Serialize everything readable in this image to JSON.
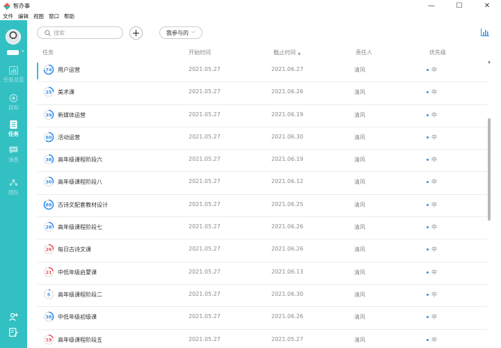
{
  "window": {
    "title": "智办事",
    "controls": [
      "—",
      "☐",
      "✕"
    ]
  },
  "menu": [
    "文件",
    "编辑",
    "视图",
    "窗口",
    "帮助"
  ],
  "sidebar": {
    "items": [
      {
        "label": "任务总览",
        "icon": "chart-icon",
        "active": false
      },
      {
        "label": "目标",
        "icon": "target-icon",
        "active": false
      },
      {
        "label": "任务",
        "icon": "task-list-icon",
        "active": true
      },
      {
        "label": "消息",
        "icon": "message-icon",
        "active": false
      },
      {
        "label": "团队",
        "icon": "team-icon",
        "active": false
      }
    ]
  },
  "toolbar": {
    "search_placeholder": "搜索",
    "add_label": "+",
    "filter_label": "我参与的"
  },
  "table": {
    "headers": {
      "task": "任务",
      "start": "开始时间",
      "end": "截止时间",
      "owner": "责任人",
      "priority": "优先级"
    },
    "rows": [
      {
        "progress": "74",
        "color": "#2d8cf0",
        "name": "用户运营",
        "start": "2021.05.27",
        "end": "2021.06.27",
        "owner": "清风",
        "priority": "中"
      },
      {
        "progress": "25",
        "color": "#2d8cf0",
        "name": "美术课",
        "start": "2021.05.27",
        "end": "2021.06.26",
        "owner": "清风",
        "priority": "中"
      },
      {
        "progress": "39",
        "color": "#2d8cf0",
        "name": "新媒体运营",
        "start": "2021.05.27",
        "end": "2021.06.19",
        "owner": "清风",
        "priority": "中"
      },
      {
        "progress": "60",
        "color": "#2d8cf0",
        "name": "活动运营",
        "start": "2021.05.27",
        "end": "2021.06.30",
        "owner": "清风",
        "priority": "中"
      },
      {
        "progress": "38",
        "color": "#2d8cf0",
        "name": "高年级课程阶段六",
        "start": "2021.05.27",
        "end": "2021.06.19",
        "owner": "清风",
        "priority": "中"
      },
      {
        "progress": "30",
        "color": "#2d8cf0",
        "name": "高年级课程阶段八",
        "start": "2021.05.27",
        "end": "2021.06.12",
        "owner": "清风",
        "priority": "中"
      },
      {
        "progress": "88",
        "color": "#2d8cf0",
        "name": "古诗文配套教材设计",
        "start": "2021.05.27",
        "end": "2021.06.25",
        "owner": "清风",
        "priority": "中"
      },
      {
        "progress": "28",
        "color": "#2d8cf0",
        "name": "高年级课程阶段七",
        "start": "2021.05.27",
        "end": "2021.06.26",
        "owner": "清风",
        "priority": "中"
      },
      {
        "progress": "26",
        "color": "#ed4d4d",
        "name": "每日古诗文课",
        "start": "2021.05.27",
        "end": "2021.06.26",
        "owner": "清风",
        "priority": "中"
      },
      {
        "progress": "21",
        "color": "#ed4d4d",
        "name": "中低年级启蒙课",
        "start": "2021.05.27",
        "end": "2021.06.13",
        "owner": "清风",
        "priority": "中"
      },
      {
        "progress": "5",
        "color": "#2d8cf0",
        "name": "高年级课程阶段二",
        "start": "2021.05.27",
        "end": "2021.06.30",
        "owner": "清风",
        "priority": "中"
      },
      {
        "progress": "38",
        "color": "#2d8cf0",
        "name": "中低年级初级课",
        "start": "2021.05.27",
        "end": "2021.06.26",
        "owner": "清风",
        "priority": "中"
      },
      {
        "progress": "19",
        "color": "#ed4d4d",
        "name": "高年级课程阶段五",
        "start": "2021.05.27",
        "end": "2021.05.27",
        "owner": "清风",
        "priority": "中"
      }
    ]
  }
}
